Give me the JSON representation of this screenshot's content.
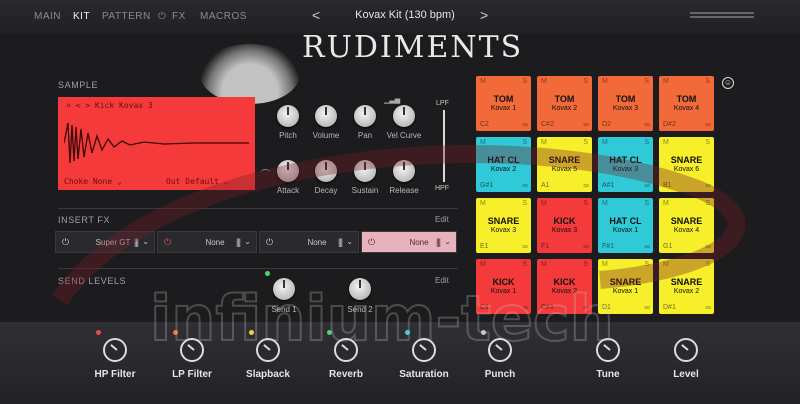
{
  "nav": {
    "main": "MAIN",
    "kit": "KIT",
    "pattern": "PATTERN",
    "fx": "FX",
    "macros": "MACROS"
  },
  "preset": {
    "name": "Kovax Kit (130 bpm)",
    "prev": "<",
    "next": ">"
  },
  "title": "RUDIMENTS",
  "sample": {
    "section": "SAMPLE",
    "name": "Kick Kovax 3",
    "nav_glyphs": "⌕ < >",
    "choke_label": "Choke",
    "choke_value": "None",
    "output_label": "Out",
    "output_value": "Default",
    "knobs_row1": [
      "Pitch",
      "Volume",
      "Pan",
      "Vel Curve"
    ],
    "knobs_row2": [
      "Attack",
      "Decay",
      "Sustain",
      "Release"
    ],
    "lpf": "LPF",
    "hpf": "HPF"
  },
  "insert_fx": {
    "section": "INSERT FX",
    "edit": "Edit",
    "slots": [
      {
        "name": "Super GT",
        "active": false
      },
      {
        "name": "None",
        "active": false
      },
      {
        "name": "None",
        "active": false
      },
      {
        "name": "None",
        "active": true
      }
    ]
  },
  "send_levels": {
    "section": "SEND LEVELS",
    "edit": "Edit",
    "send1": "Send 1",
    "send2": "Send 2"
  },
  "pads": [
    {
      "type": "TOM",
      "sample": "Kovax 1",
      "note": "C2",
      "color": "#f36a3a"
    },
    {
      "type": "TOM",
      "sample": "Kovax 2",
      "note": "C#2",
      "color": "#f36a3a"
    },
    {
      "type": "TOM",
      "sample": "Kovax 3",
      "note": "D2",
      "color": "#f36a3a"
    },
    {
      "type": "TOM",
      "sample": "Kovax 4",
      "note": "D#2",
      "color": "#f36a3a"
    },
    {
      "type": "HAT CL",
      "sample": "Kovax 2",
      "note": "G#1",
      "color": "#2fc9d8"
    },
    {
      "type": "SNARE",
      "sample": "Kovax 5",
      "note": "A1",
      "color": "#f6ef2a"
    },
    {
      "type": "HAT CL",
      "sample": "Kovax 3",
      "note": "A#1",
      "color": "#2fc9d8"
    },
    {
      "type": "SNARE",
      "sample": "Kovax 6",
      "note": "B1",
      "color": "#f6ef2a"
    },
    {
      "type": "SNARE",
      "sample": "Kovax 3",
      "note": "E1",
      "color": "#f6ef2a"
    },
    {
      "type": "KICK",
      "sample": "Kovax 3",
      "note": "F1",
      "color": "#f43a3a"
    },
    {
      "type": "HAT CL",
      "sample": "Kovax 1",
      "note": "F#1",
      "color": "#2fc9d8"
    },
    {
      "type": "SNARE",
      "sample": "Kovax 4",
      "note": "G1",
      "color": "#f6ef2a"
    },
    {
      "type": "KICK",
      "sample": "Kovax 1",
      "note": "C1",
      "color": "#f43a3a"
    },
    {
      "type": "KICK",
      "sample": "Kovax 2",
      "note": "C#1",
      "color": "#f43a3a"
    },
    {
      "type": "SNARE",
      "sample": "Kovax 1",
      "note": "D1",
      "color": "#f6ef2a"
    },
    {
      "type": "SNARE",
      "sample": "Kovax 2",
      "note": "D#1",
      "color": "#f6ef2a"
    }
  ],
  "pad_ms": [
    "M",
    "S"
  ],
  "macros": [
    {
      "label": "HP Filter",
      "dot": "#e84a4a"
    },
    {
      "label": "LP Filter",
      "dot": "#f0783a"
    },
    {
      "label": "Slapback",
      "dot": "#e8d83a"
    },
    {
      "label": "Reverb",
      "dot": "#4ad86a"
    },
    {
      "label": "Saturation",
      "dot": "#3ad0e0"
    },
    {
      "label": "Punch",
      "dot": "#c8c8c8"
    },
    {
      "label": "Tune",
      "dot": ""
    },
    {
      "label": "Level",
      "dot": ""
    }
  ],
  "watermark": "infinium-tech"
}
